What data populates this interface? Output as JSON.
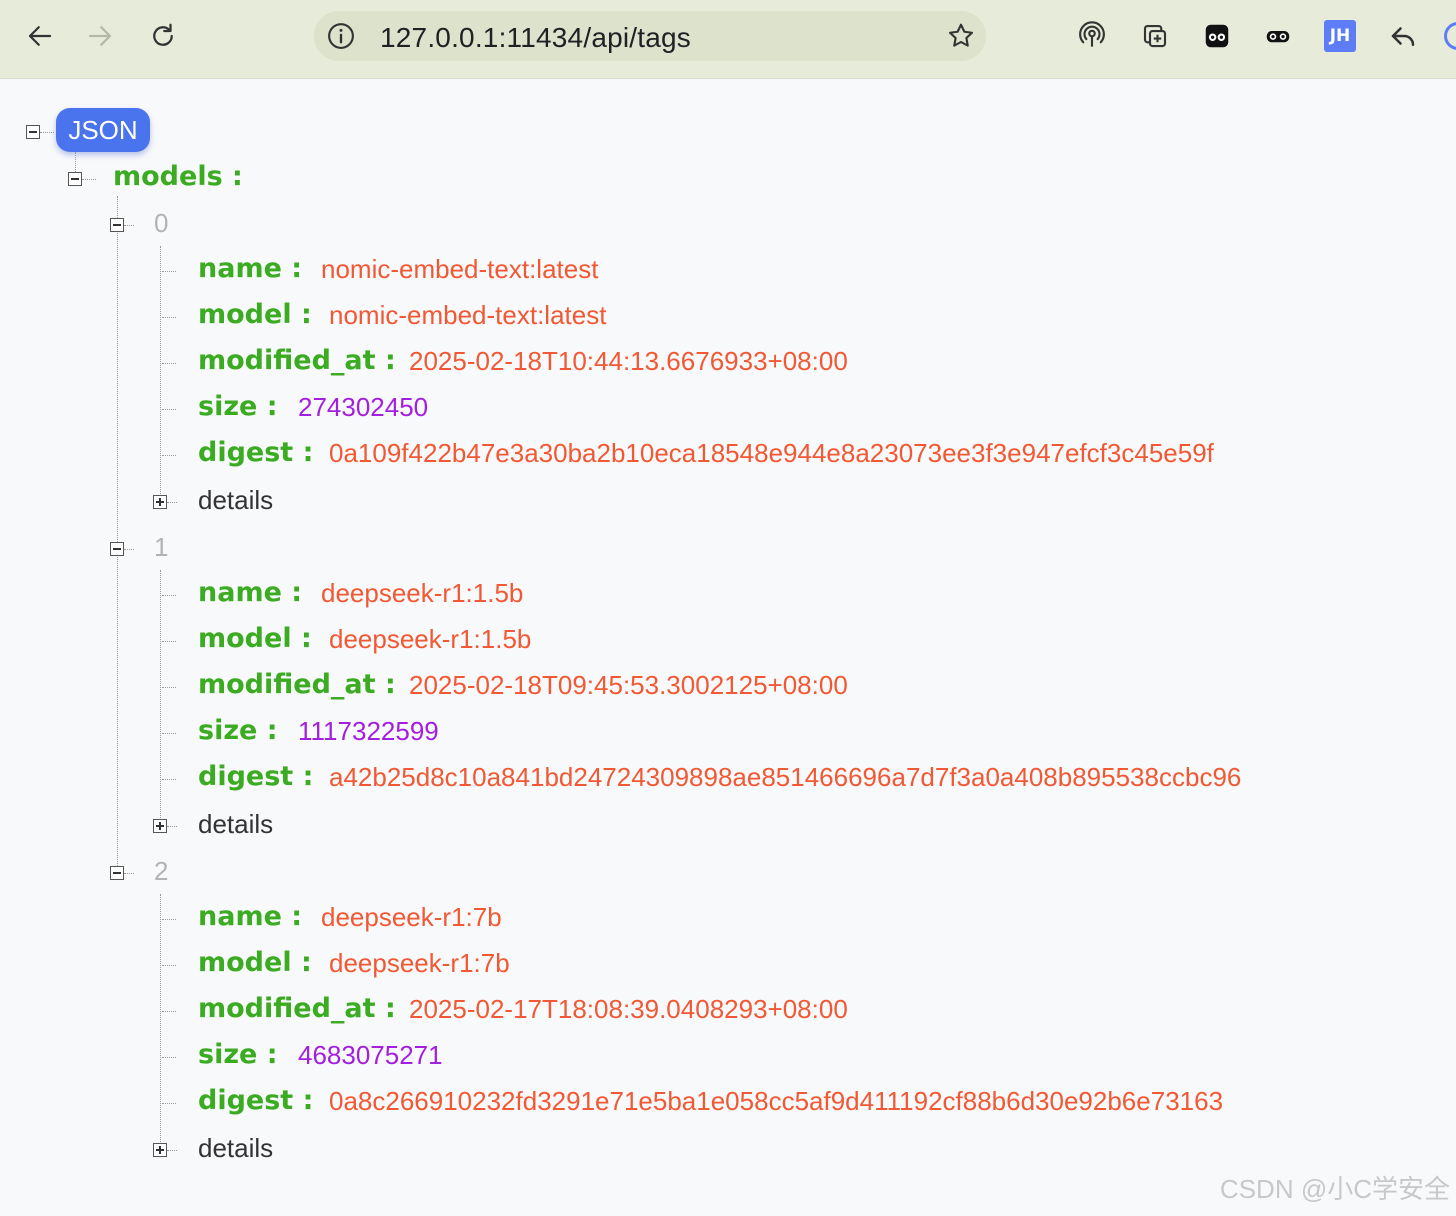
{
  "browser": {
    "url": "127.0.0.1:11434/api/tags",
    "ext_badge": "JH"
  },
  "viewer": {
    "root_label": "JSON",
    "models_key": "models :",
    "details_label": "details",
    "name_key": "name :",
    "model_key": "model :",
    "modified_key": "modified_at :",
    "size_key": "size :",
    "digest_key": "digest :"
  },
  "models": [
    {
      "index": "0",
      "name": "nomic-embed-text:latest",
      "model": "nomic-embed-text:latest",
      "modified_at": "2025-02-18T10:44:13.6676933+08:00",
      "size": "274302450",
      "digest": "0a109f422b47e3a30ba2b10eca18548e944e8a23073ee3f3e947efcf3c45e59f"
    },
    {
      "index": "1",
      "name": "deepseek-r1:1.5b",
      "model": "deepseek-r1:1.5b",
      "modified_at": "2025-02-18T09:45:53.3002125+08:00",
      "size": "1117322599",
      "digest": "a42b25d8c10a841bd24724309898ae851466696a7d7f3a0a408b895538ccbc96"
    },
    {
      "index": "2",
      "name": "deepseek-r1:7b",
      "model": "deepseek-r1:7b",
      "modified_at": "2025-02-17T18:08:39.0408293+08:00",
      "size": "4683075271",
      "digest": "0a8c266910232fd3291e71e5ba1e058cc5af9d411192cf88b6d30e92b6e73163"
    }
  ],
  "watermark": "CSDN @小C学安全",
  "colors": {
    "key": "#3bab21",
    "string": "#f25834",
    "number": "#a41ee0",
    "badge": "#4a74ee"
  }
}
